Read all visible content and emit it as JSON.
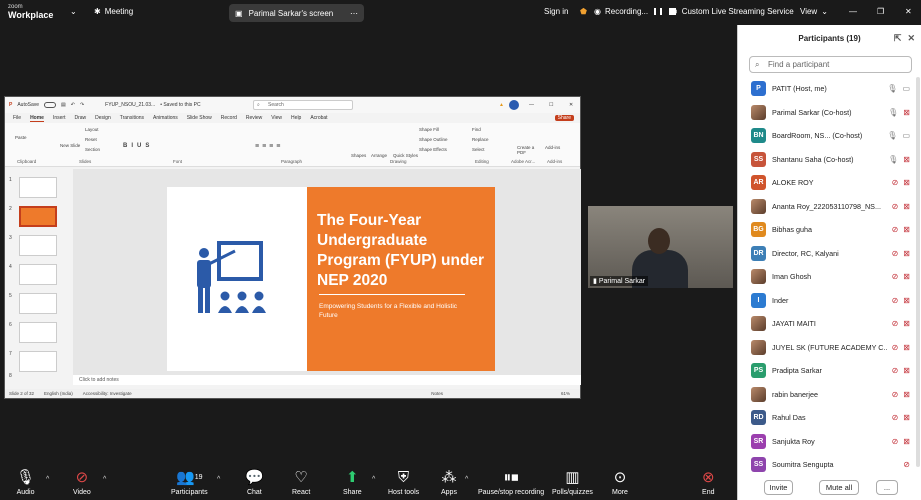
{
  "app": {
    "logo_line1": "zoom",
    "logo_line2": "Workplace"
  },
  "topbar": {
    "meeting_label": "Meeting",
    "share_label": "Parimal Sarkar's screen",
    "sign_in": "Sign in",
    "recording": "Recording...",
    "live_stream": "Custom Live Streaming Service",
    "view": "View"
  },
  "ppt": {
    "autosave": "AutoSave",
    "filename": "FYUP_NSOU_21.03...",
    "saved": "• Saved to this PC",
    "search_placeholder": "Search",
    "tabs": [
      "File",
      "Home",
      "Insert",
      "Draw",
      "Design",
      "Transitions",
      "Animations",
      "Slide Show",
      "Record",
      "Review",
      "View",
      "Help",
      "Acrobat"
    ],
    "share_btn": "Share",
    "groups": {
      "clipboard": "Clipboard",
      "slides": "Slides",
      "font": "Font",
      "paragraph": "Paragraph",
      "drawing": "Drawing",
      "editing": "Editing",
      "adobe": "Adobe Acr...",
      "addins": "Add-ins"
    },
    "ribbon": {
      "paste": "Paste",
      "new_slide": "New Slide",
      "layout": "Layout",
      "reset": "Reset",
      "section": "Section",
      "shapes": "Shapes",
      "arrange": "Arrange",
      "quick_styles": "Quick Styles",
      "shape_fill": "Shape Fill",
      "shape_outline": "Shape Outline",
      "shape_effects": "Shape Effects",
      "find": "Find",
      "replace": "Replace",
      "select": "Select",
      "create_pdf": "Create a PDF",
      "addins": "Add-ins"
    },
    "thumb_numbers": [
      "1",
      "2",
      "3",
      "4",
      "5",
      "6",
      "7",
      "8"
    ],
    "slide_title": "The Four-Year Undergraduate Program (FYUP) under NEP 2020",
    "slide_subtitle": "Empowering Students for a Flexible and Holistic Future",
    "notes_placeholder": "Click to add notes",
    "status_slide": "Slide 2 of 32",
    "status_lang": "English (India)",
    "status_access": "Accessibility: Investigate",
    "status_notes": "Notes",
    "zoom_level": "61%"
  },
  "video": {
    "name": "Parimal Sarkar"
  },
  "participants": {
    "title": "Participants (19)",
    "search_placeholder": "Find a participant",
    "list": [
      {
        "initials": "P",
        "color": "#2d6fcf",
        "name": "PATIT (Host, me)",
        "mic": "muted-grey",
        "cam": "grey"
      },
      {
        "initials": "",
        "color": "photo",
        "name": "Parimal Sarkar (Co-host)",
        "mic": "on",
        "cam": "off"
      },
      {
        "initials": "BN",
        "color": "#1f8a8a",
        "name": "BoardRoom, NS... (Co-host)",
        "mic": "muted-grey",
        "cam": "grey"
      },
      {
        "initials": "SS",
        "color": "#c7543a",
        "name": "Shantanu Saha (Co-host)",
        "mic": "muted-grey",
        "cam": "off"
      },
      {
        "initials": "AR",
        "color": "#d0542c",
        "name": "ALOKE ROY",
        "mic": "muted",
        "cam": "off"
      },
      {
        "initials": "",
        "color": "photo",
        "name": "Ananta Roy_222053110798_NS...",
        "mic": "muted",
        "cam": "off"
      },
      {
        "initials": "BG",
        "color": "#e08a1e",
        "name": "Bibhas guha",
        "mic": "muted",
        "cam": "off"
      },
      {
        "initials": "DR",
        "color": "#3d7fb6",
        "name": "Director, RC, Kalyani",
        "mic": "muted",
        "cam": "off"
      },
      {
        "initials": "",
        "color": "photo",
        "name": "Iman Ghosh",
        "mic": "muted",
        "cam": "off"
      },
      {
        "initials": "I",
        "color": "#2c7bd1",
        "name": "Inder",
        "mic": "muted",
        "cam": "off"
      },
      {
        "initials": "",
        "color": "photo",
        "name": "JAYATI MAITI",
        "mic": "muted",
        "cam": "off"
      },
      {
        "initials": "",
        "color": "photo",
        "name": "JUYEL SK (FUTURE ACADEMY C...",
        "mic": "muted",
        "cam": "off"
      },
      {
        "initials": "PS",
        "color": "#2a9d6d",
        "name": "Pradipta Sarkar",
        "mic": "muted",
        "cam": "off"
      },
      {
        "initials": "",
        "color": "photo",
        "name": "rabin banerjee",
        "mic": "muted",
        "cam": "off"
      },
      {
        "initials": "RD",
        "color": "#3c5a8a",
        "name": "Rahul Das",
        "mic": "muted",
        "cam": "off"
      },
      {
        "initials": "SR",
        "color": "#9b3fae",
        "name": "Sanjukta Roy",
        "mic": "muted",
        "cam": "off"
      },
      {
        "initials": "SS",
        "color": "#8e44ad",
        "name": "Soumitra Sengupta",
        "mic": "muted",
        "cam": ""
      }
    ],
    "invite": "Invite",
    "mute_all": "Mute all",
    "more": "..."
  },
  "toolbar": {
    "audio": "Audio",
    "video": "Video",
    "participants": "Participants",
    "participants_count": "19",
    "chat": "Chat",
    "react": "React",
    "share": "Share",
    "host_tools": "Host tools",
    "apps": "Apps",
    "pause_rec": "Pause/stop recording",
    "polls": "Polls/quizzes",
    "more": "More",
    "end": "End"
  }
}
